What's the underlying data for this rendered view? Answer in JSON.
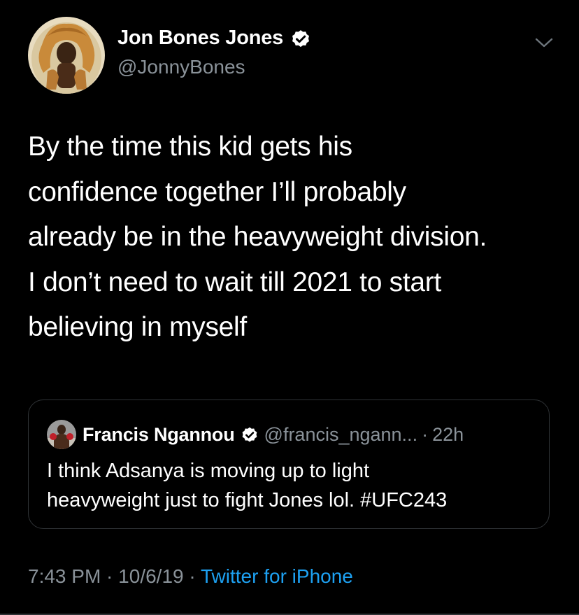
{
  "author": {
    "display_name": "Jon Bones Jones",
    "handle": "@JonnyBones",
    "verified": true,
    "avatar_icon": "lion-headdress-avatar"
  },
  "tweet": {
    "lines": [
      "By the time this kid gets his",
      "confidence together I’ll probably",
      "already be in the heavyweight division.",
      "I don’t need to wait till 2021 to start",
      "believing in myself"
    ]
  },
  "quoted": {
    "display_name": "Francis Ngannou",
    "handle": "@francis_ngann...",
    "separator": "·",
    "time": "22h",
    "verified": true,
    "lines": [
      "I think Adsanya is moving up to light",
      "heavyweight just to fight Jones lol. #UFC243"
    ]
  },
  "meta": {
    "time": "7:43 PM",
    "separator1": " · ",
    "date": "10/6/19",
    "separator2": " · ",
    "source": "Twitter for iPhone"
  },
  "colors": {
    "background": "#000000",
    "text": "#ffffff",
    "secondary": "#8a9299",
    "link": "#1da1f2",
    "border": "#2f3336"
  }
}
